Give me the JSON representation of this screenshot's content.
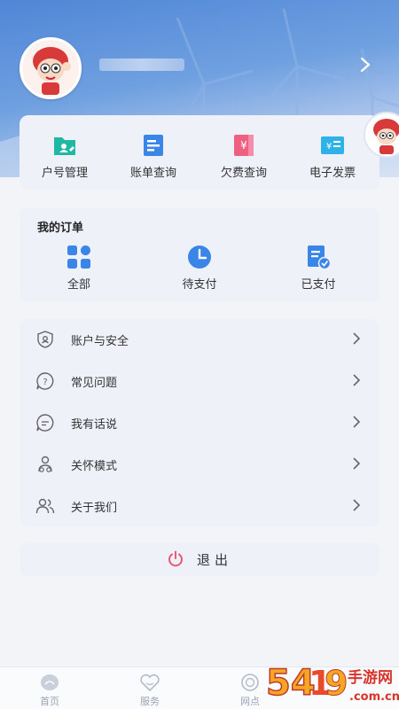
{
  "header": {
    "username": "",
    "avatar_icon": "mascot-avatar-icon",
    "chevron_icon": "chevron-right-icon"
  },
  "quick_actions": [
    {
      "label": "户号管理",
      "icon": "account-id-icon",
      "color": "#1fb8a2"
    },
    {
      "label": "账单查询",
      "icon": "bill-query-icon",
      "color": "#3a86e8"
    },
    {
      "label": "欠费查询",
      "icon": "arrears-query-icon",
      "color": "#ef5f82"
    },
    {
      "label": "电子发票",
      "icon": "e-invoice-icon",
      "color": "#2fb2e8"
    }
  ],
  "orders": {
    "title": "我的订单",
    "items": [
      {
        "label": "全部",
        "icon": "all-orders-icon"
      },
      {
        "label": "待支付",
        "icon": "pending-payment-icon"
      },
      {
        "label": "已支付",
        "icon": "paid-icon"
      }
    ]
  },
  "menu": [
    {
      "label": "账户与安全",
      "icon": "shield-icon"
    },
    {
      "label": "常见问题",
      "icon": "question-icon"
    },
    {
      "label": "我有话说",
      "icon": "chat-icon"
    },
    {
      "label": "关怀模式",
      "icon": "care-mode-icon"
    },
    {
      "label": "关于我们",
      "icon": "users-icon"
    }
  ],
  "logout": {
    "label": "退出",
    "icon": "power-icon",
    "color": "#e8587a"
  },
  "tabbar": [
    {
      "label": "首页",
      "icon": "home-icon"
    },
    {
      "label": "服务",
      "icon": "service-icon"
    },
    {
      "label": "网点",
      "icon": "outlet-icon"
    }
  ],
  "colors": {
    "accent": "#3a86e8",
    "page_bg": "#f2f4f8",
    "card_bg": "#eef1f8"
  }
}
